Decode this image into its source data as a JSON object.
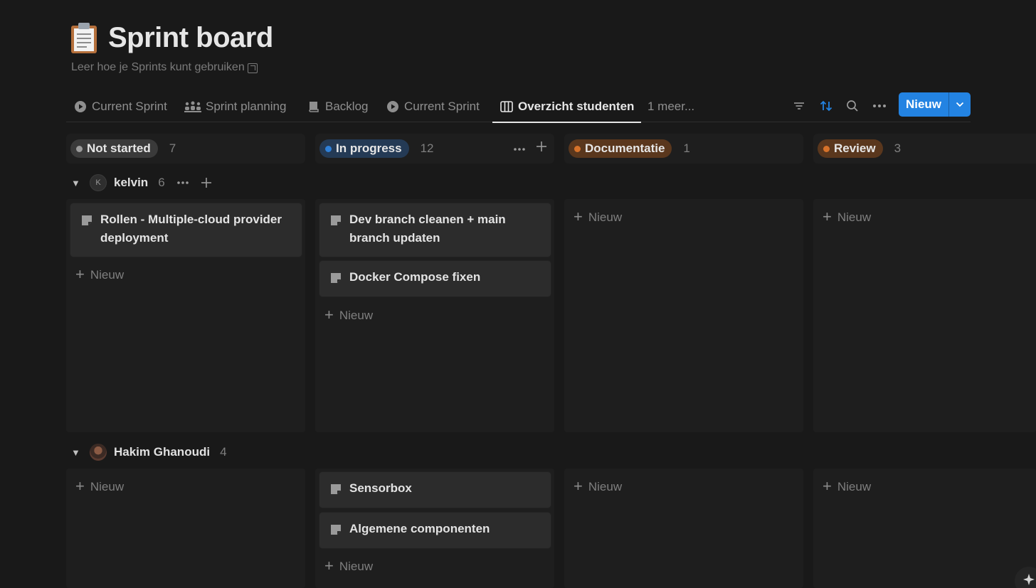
{
  "page": {
    "title": "Sprint board",
    "title_icon": "clipboard-icon",
    "subtitle": "Leer hoe je Sprints kunt gebruiken"
  },
  "tabs": [
    {
      "label": "Current Sprint",
      "icon": "play-circle-icon"
    },
    {
      "label": "Sprint planning",
      "icon": "people-icon"
    },
    {
      "label": "Backlog",
      "icon": "book-icon"
    },
    {
      "label": "Current Sprint",
      "icon": "play-circle-icon"
    },
    {
      "label": "Overzicht studenten",
      "icon": "board-icon",
      "active": true
    }
  ],
  "tabs_more": "1 meer...",
  "toolbar": {
    "new_label": "Nieuw",
    "accent": "#2383e2"
  },
  "columns": [
    {
      "status": "Not started",
      "count": "7",
      "dot": "#9b9b9b",
      "pill": "#3a3a3a"
    },
    {
      "status": "In progress",
      "count": "12",
      "dot": "#2f80d8",
      "pill": "#243a55"
    },
    {
      "status": "Documentatie",
      "count": "1",
      "dot": "#d6722a",
      "pill": "#5a371d"
    },
    {
      "status": "Review",
      "count": "3",
      "dot": "#d6722a",
      "pill": "#5a371d"
    }
  ],
  "groups": [
    {
      "name": "kelvin",
      "avatar_initial": "K",
      "count": "6",
      "cards": {
        "not_started": [
          "Rollen - Multiple-cloud provider deployment"
        ],
        "in_progress": [
          "Dev branch cleanen + main branch updaten",
          "Docker Compose fixen"
        ]
      }
    },
    {
      "name": "Hakim Ghanoudi",
      "count": "4",
      "cards": {
        "in_progress": [
          "Sensorbox",
          "Algemene componenten"
        ]
      }
    }
  ],
  "add_new_label": "Nieuw"
}
